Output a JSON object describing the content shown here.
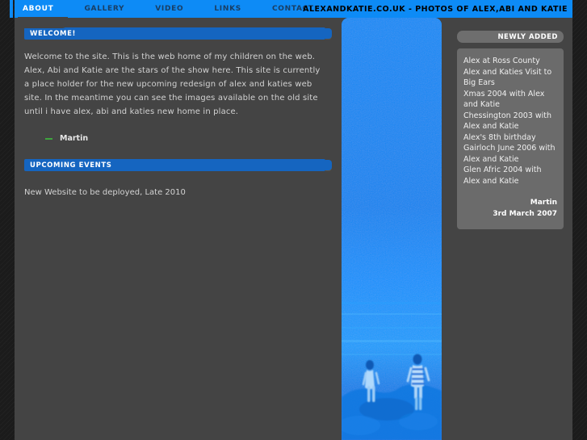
{
  "nav": {
    "tabs": [
      {
        "label": "About",
        "active": true
      },
      {
        "label": "Gallery",
        "active": false
      },
      {
        "label": "Video",
        "active": false
      },
      {
        "label": "Links",
        "active": false
      },
      {
        "label": "Contact",
        "active": false
      }
    ]
  },
  "header": {
    "site_title": "alexandkatie.co.uk - Photos of Alex,Abi and Katie"
  },
  "main": {
    "welcome": {
      "heading": "Welcome!",
      "paragraph": "Welcome to the site. This is the web home of my children on the web. Alex, Abi and Katie are the stars of the show here. This site is currently a place holder for the new upcoming redesign of alex and katies web site. In the meantime you can see the images available on the old site until i have alex, abi and katies new home in place.",
      "signature": "Martin"
    },
    "events": {
      "heading": "Upcoming Events",
      "text": "New Website to be deployed, Late 2010"
    }
  },
  "sidebar": {
    "heading": "Newly Added",
    "items": [
      "Alex at Ross County",
      "Alex and Katies Visit to Big Ears",
      "Xmas 2004 with Alex and Katie",
      "Chessington 2003 with Alex and Katie",
      "Alex's 8th birthday",
      "Gairloch June 2006 with Alex and Katie",
      "Glen Afric 2004 with Alex and Katie"
    ],
    "author": "Martin",
    "date": "3rd March 2007"
  },
  "photo": {
    "alt": "Two children standing on a rocky beach by the sea, tinted blue"
  },
  "colors": {
    "nav_blue": "#0d8bf6",
    "panel_blue": "#1565c0",
    "page_bg": "#444444",
    "edge_dark": "#1c1c1c",
    "sidebar_grey": "#6b6b6b",
    "accent_green": "#3ea53e"
  }
}
